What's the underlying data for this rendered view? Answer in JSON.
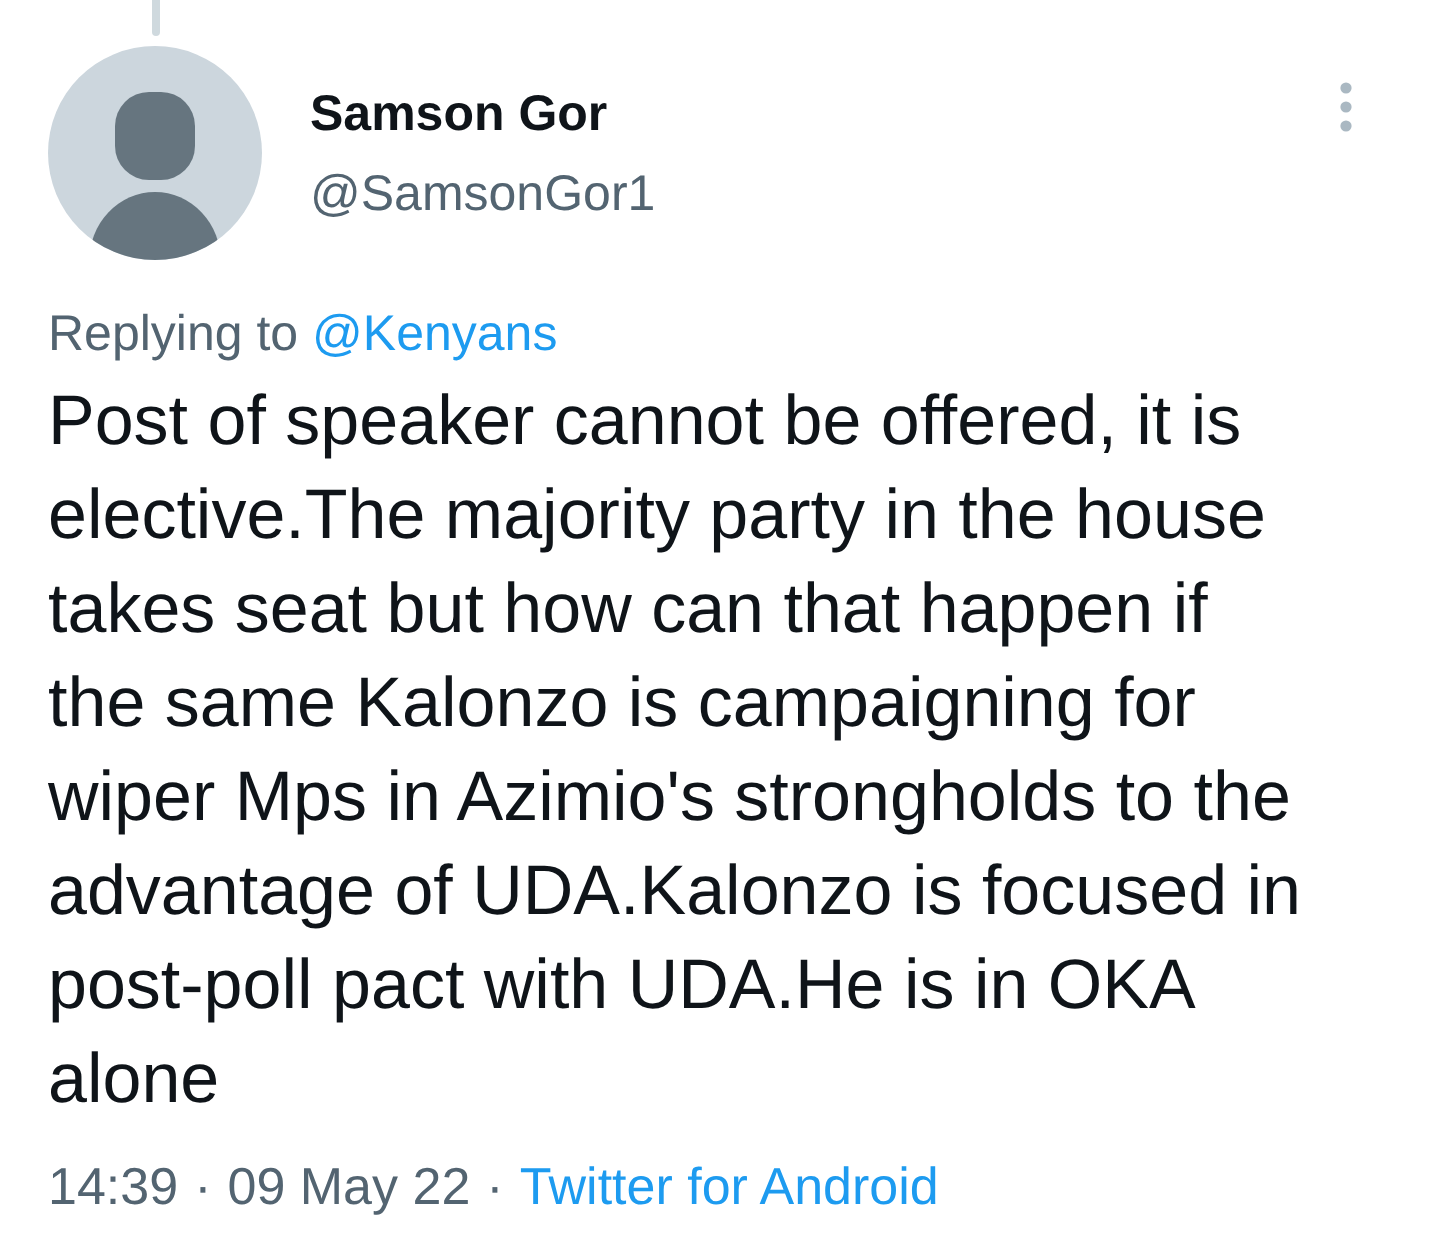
{
  "tweet": {
    "author": {
      "name": "Samson Gor",
      "handle": "@SamsonGor1"
    },
    "reply": {
      "label": "Replying to",
      "handle": "@Kenyans"
    },
    "text": "Post of speaker cannot be offered, it is elective.The majority party in the house takes seat but how can that happen if the same Kalonzo is campaigning for wiper Mps in Azimio's strongholds to the advantage of UDA.Kalonzo is focused in post-poll pact with UDA.He is in OKA alone",
    "footer": [
      {
        "kind": "time",
        "text": "14:39"
      },
      {
        "kind": "separator",
        "text": "·"
      },
      {
        "kind": "date",
        "text": "09 May 22"
      },
      {
        "kind": "separator",
        "text": "·"
      },
      {
        "kind": "source",
        "text": "Twitter for Android"
      }
    ]
  }
}
